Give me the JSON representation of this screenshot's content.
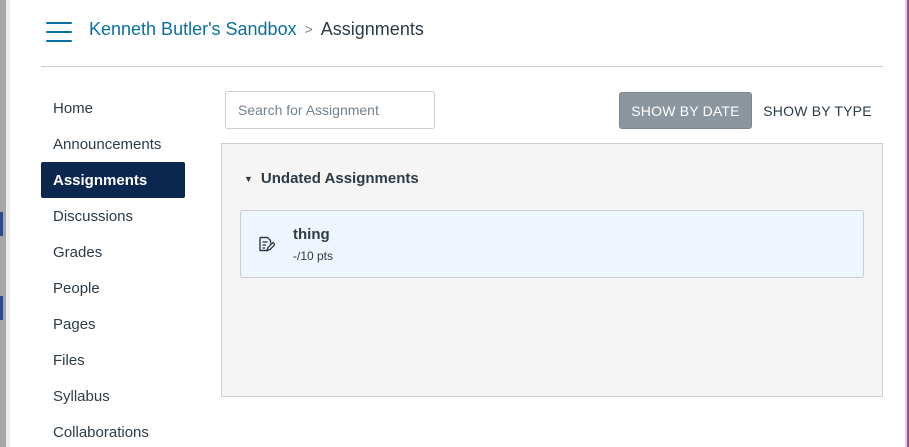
{
  "header": {
    "course_link": "Kenneth Butler's Sandbox",
    "separator": ">",
    "current_page": "Assignments"
  },
  "sidebar": {
    "items": [
      {
        "label": "Home",
        "active": false
      },
      {
        "label": "Announcements",
        "active": false
      },
      {
        "label": "Assignments",
        "active": true
      },
      {
        "label": "Discussions",
        "active": false
      },
      {
        "label": "Grades",
        "active": false
      },
      {
        "label": "People",
        "active": false
      },
      {
        "label": "Pages",
        "active": false
      },
      {
        "label": "Files",
        "active": false
      },
      {
        "label": "Syllabus",
        "active": false
      },
      {
        "label": "Collaborations",
        "active": false
      }
    ]
  },
  "toolbar": {
    "search_placeholder": "Search for Assignment",
    "search_value": "",
    "show_by_date_label": "SHOW BY DATE",
    "show_by_type_label": "SHOW BY TYPE",
    "active_view": "SHOW BY DATE"
  },
  "assignment_groups": [
    {
      "title": "Undated Assignments",
      "expanded": true,
      "assignments": [
        {
          "name": "thing",
          "points": "-/10 pts",
          "icon": "assignment-icon"
        }
      ]
    }
  ],
  "icons": {
    "menu": "hamburger-menu-icon",
    "group_toggle": "caret-down-icon",
    "assignment": "assignment-icon"
  },
  "colors": {
    "link": "#0770a3",
    "nav_active_bg": "#0b274f",
    "view_button_active_bg": "#8b969e",
    "panel_bg": "#f5f5f5",
    "assignment_row_bg": "#eef5fc"
  }
}
